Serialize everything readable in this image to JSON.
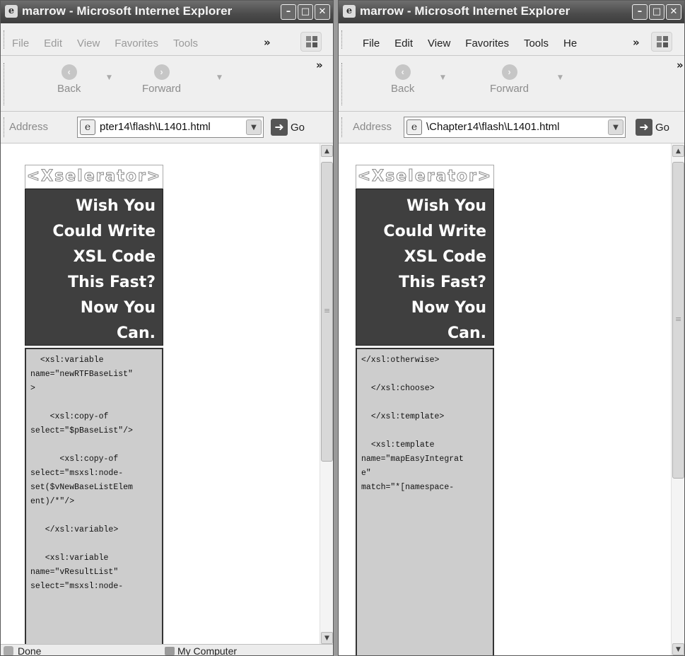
{
  "windows": [
    {
      "title": "marrow - Microsoft Internet Explorer",
      "menu": [
        "File",
        "Edit",
        "View",
        "Favorites",
        "Tools"
      ],
      "menu_overflow": "»",
      "back_label": "Back",
      "forward_label": "Forward",
      "toolbar_overflow": "»",
      "address_label": "Address",
      "url": "pter14\\flash\\L1401.html",
      "go_label": "Go",
      "logo_text": "<Xselerator>",
      "pitch_lines": [
        "Wish You",
        "Could Write",
        "XSL Code",
        "This Fast?",
        "Now You",
        "Can."
      ],
      "code": "  <xsl:variable\nname=\"newRTFBaseList\"\n>\n\n    <xsl:copy-of\nselect=\"$pBaseList\"/>\n\n      <xsl:copy-of\nselect=\"msxsl:node-\nset($vNewBaseListElem\nent)/*\"/>\n\n   </xsl:variable>\n\n   <xsl:variable\nname=\"vResultList\"\nselect=\"msxsl:node-",
      "status_text": "Done",
      "status_zone": "My Computer"
    },
    {
      "title": "marrow - Microsoft Internet Explorer",
      "menu": [
        "File",
        "Edit",
        "View",
        "Favorites",
        "Tools",
        "He"
      ],
      "menu_overflow": "»",
      "back_label": "Back",
      "forward_label": "Forward",
      "toolbar_overflow": "»",
      "address_label": "Address",
      "url": "\\Chapter14\\flash\\L1401.html",
      "go_label": "Go",
      "logo_text": "<Xselerator>",
      "pitch_lines": [
        "Wish You",
        "Could Write",
        "XSL Code",
        "This Fast?",
        "Now You",
        "Can."
      ],
      "code": "</xsl:otherwise>\n\n  </xsl:choose>\n\n  </xsl:template>\n\n  <xsl:template\nname=\"mapEasyIntegrat\ne\"\nmatch=\"*[namespace-"
    }
  ],
  "icons": {
    "ie": "ie-page-icon",
    "back": "back-arrow-icon",
    "forward": "forward-arrow-icon",
    "go": "go-arrow-icon",
    "cursor": "resize-cursor-icon"
  }
}
